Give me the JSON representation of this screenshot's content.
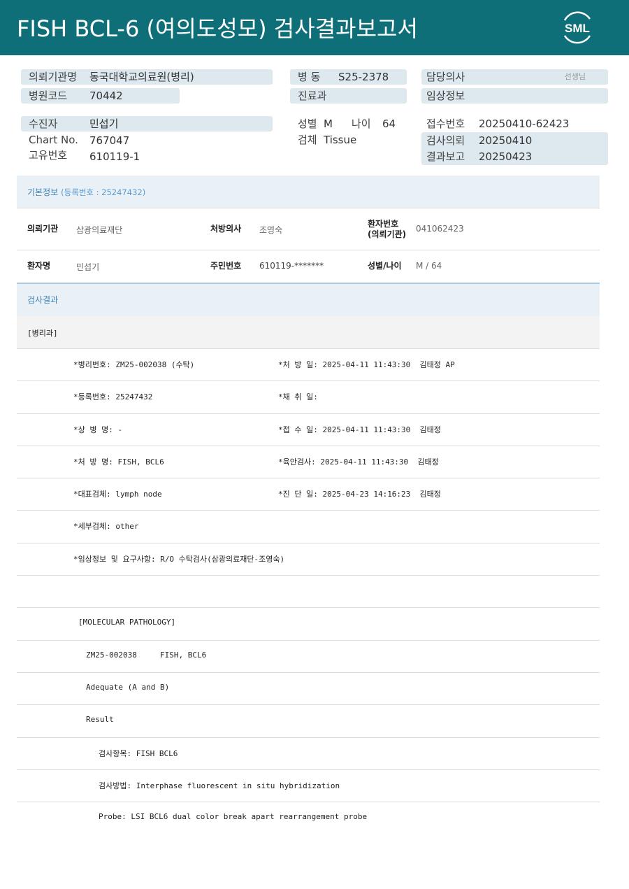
{
  "header": {
    "title": "FISH BCL-6 (여의도성모) 검사결과보고서",
    "logo_text": "SML",
    "color": "#0e6f78"
  },
  "info": {
    "institution": {
      "label": "의뢰기관명",
      "value": "동국대학교의료원(병리)"
    },
    "hospital_code": {
      "label": "병원코드",
      "value": "70442"
    },
    "ward": {
      "label": "병 동",
      "value": "S25-2378"
    },
    "department": {
      "label": "진료과",
      "value": ""
    },
    "doctor": {
      "label": "담당의사",
      "suffix": "선생님"
    },
    "clinical_info": {
      "label": "임상정보",
      "value": ""
    },
    "patient": {
      "label": "수진자",
      "value": "민섭기"
    },
    "chart_no": {
      "label": "Chart No.",
      "value": "767047"
    },
    "unique_no": {
      "label": "고유번호",
      "value": "610119-1"
    },
    "sex": {
      "label": "성별",
      "value": "M"
    },
    "age": {
      "label": "나이",
      "value": "64"
    },
    "specimen": {
      "label": "검체",
      "value": "Tissue"
    },
    "receipt_no": {
      "label": "접수번호",
      "value": "20250410-62423"
    },
    "request_date": {
      "label": "검사의뢰",
      "value": "20250410"
    },
    "report_date": {
      "label": "결과보고",
      "value": "20250423"
    }
  },
  "basic": {
    "title": "기본정보",
    "subtitle": "(등록번호 : 25247432)",
    "row1": [
      {
        "label": "의뢰기관",
        "value": "삼광의료재단"
      },
      {
        "label": "처방의사",
        "value": "조영숙"
      },
      {
        "label": "환자번호",
        "label2": "(의뢰기관)",
        "value": "041062423"
      }
    ],
    "row2": [
      {
        "label": "환자명",
        "value": "민섭기"
      },
      {
        "label": "주민번호",
        "value": "610119-*******"
      },
      {
        "label": "성별/나이",
        "value": "M / 64"
      }
    ]
  },
  "results": {
    "title": "검사결과",
    "dept": "[병리과]",
    "lines": [
      {
        "left": "*병리번호: ZM25-002038 (수탁)",
        "right": "*처 방 일: 2025-04-11 11:43:30  김태정 AP"
      },
      {
        "left": "*등록번호: 25247432",
        "right": "*채 취 일:"
      },
      {
        "left": "*상 병 명: -",
        "right": "*접 수 일: 2025-04-11 11:43:30  김태정"
      },
      {
        "left": "*처 방 명: FISH, BCL6",
        "right": "*육안검사: 2025-04-11 11:43:30  김태정"
      },
      {
        "left": "*대표검체: lymph node",
        "right": "*진 단 일: 2025-04-23 14:16:23  김태정"
      },
      {
        "left": "*세부검체: other",
        "right": ""
      },
      {
        "left": "*임상정보 및 요구사항: R/O 수탁검사(삼광의료재단-조영숙)",
        "right": ""
      }
    ],
    "molecular": [
      "[MOLECULAR PATHOLOGY]",
      "ZM25-002038     FISH, BCL6",
      "Adequate (A and B)",
      "Result",
      "검사항목: FISH BCL6",
      "검사방법: Interphase fluorescent in situ hybridization",
      "Probe: LSI BCL6 dual color break apart rearrangement probe"
    ]
  }
}
